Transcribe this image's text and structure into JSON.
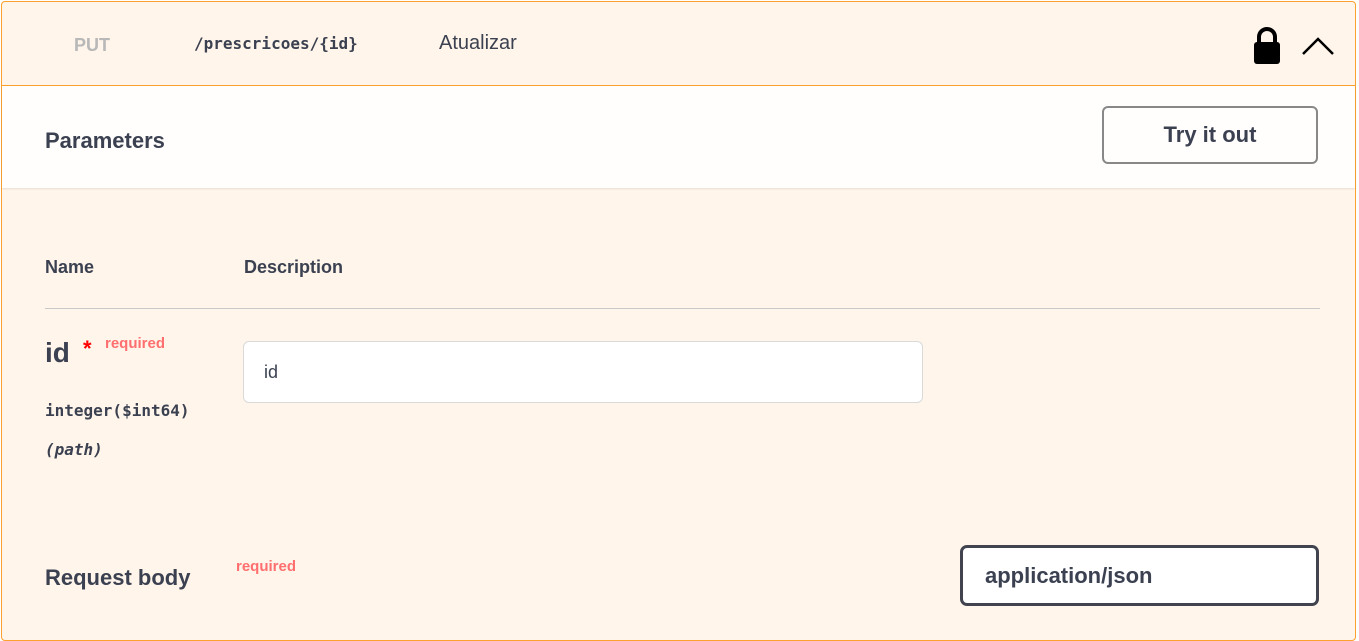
{
  "operation": {
    "method": "PUT",
    "path": "/prescricoes/{id}",
    "summary": "Atualizar",
    "lock_icon": "lock-icon",
    "collapse_icon": "chevron-up-icon",
    "accent_color": "#fca130"
  },
  "parameters_section": {
    "title": "Parameters",
    "try_button": "Try it out"
  },
  "table": {
    "headers": [
      "Name",
      "Description"
    ]
  },
  "params": [
    {
      "name": "id",
      "asterisk": "*",
      "required_label": "required",
      "type": "integer($int64)",
      "in": "(path)",
      "placeholder": "id"
    }
  ],
  "request_body": {
    "title": "Request body",
    "required_label": "required",
    "content_type": "application/json"
  }
}
